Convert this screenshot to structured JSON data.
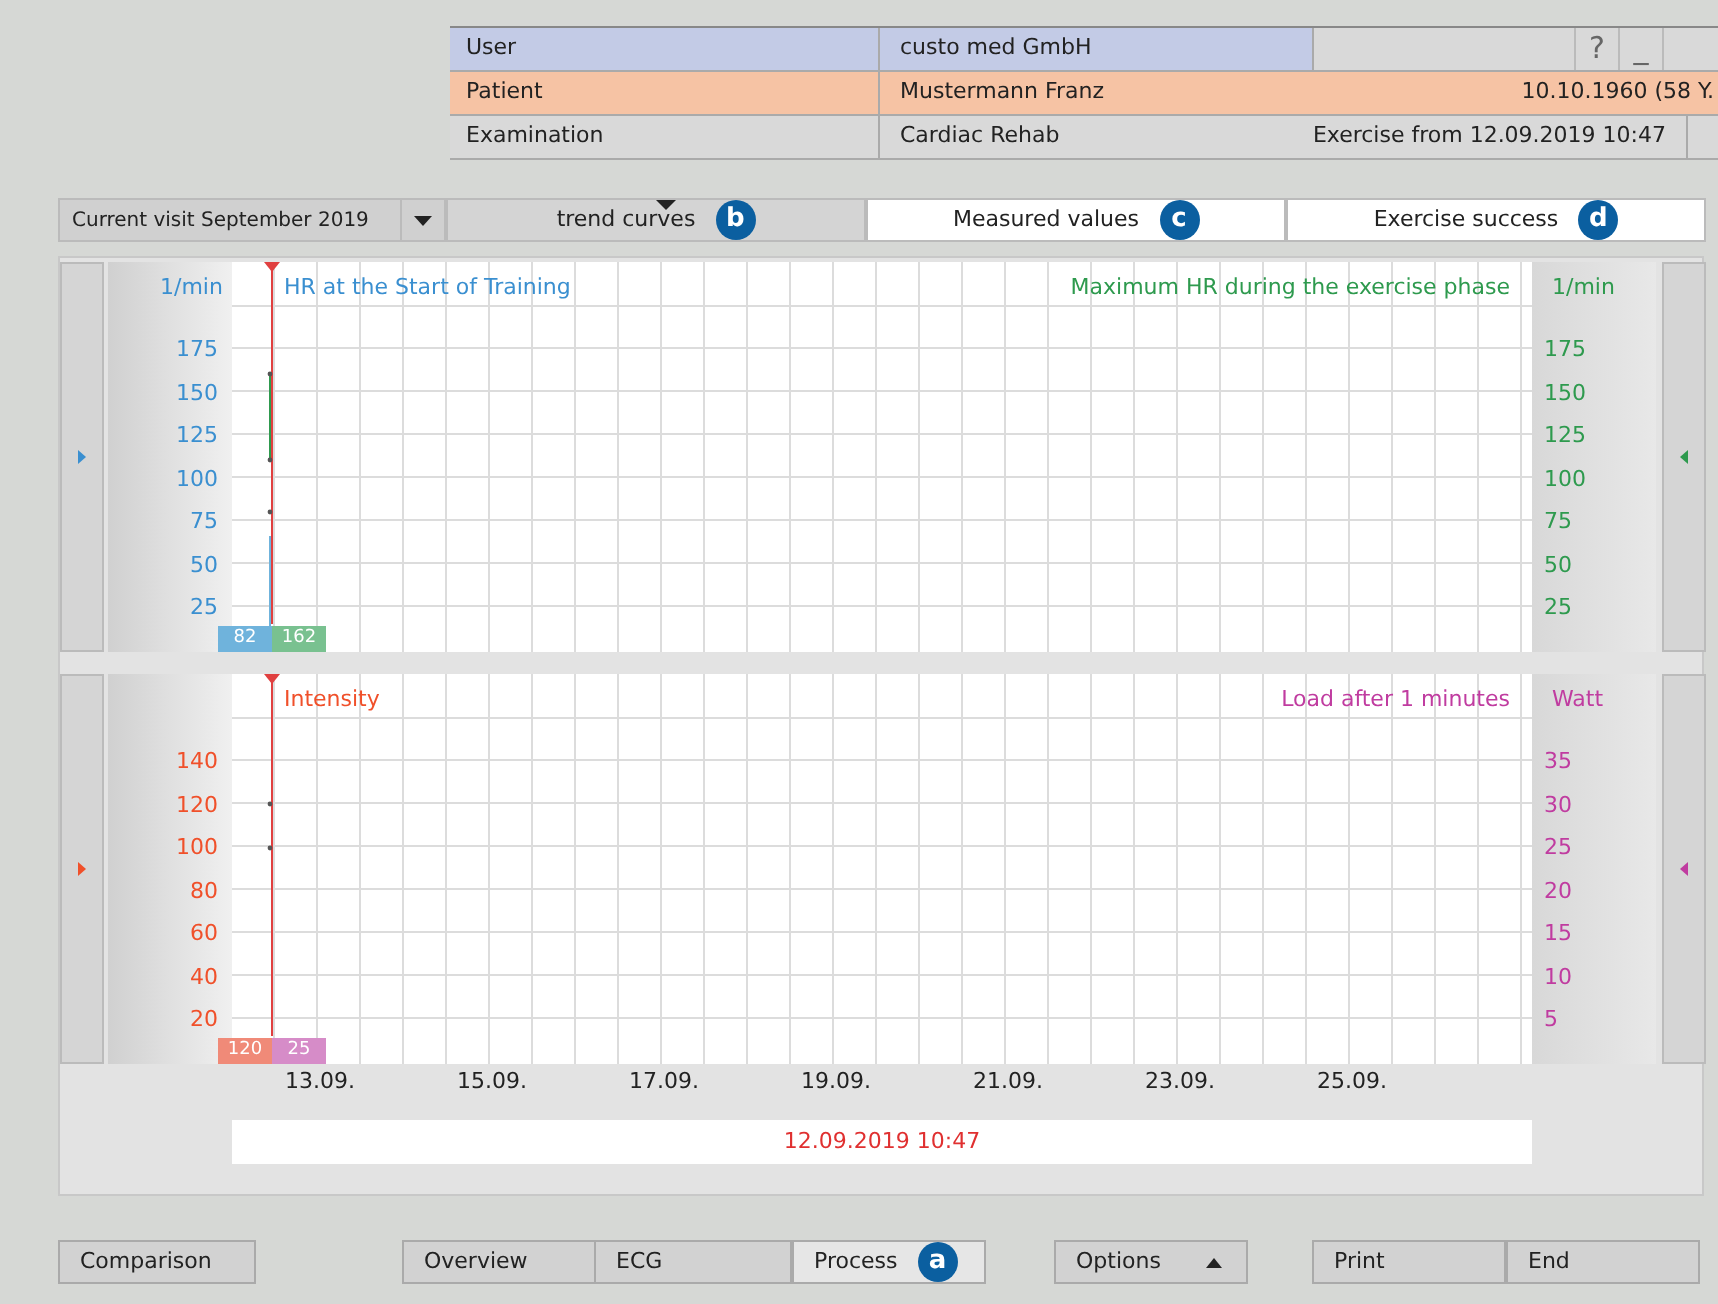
{
  "header": {
    "rows": [
      {
        "kind": "user",
        "label": "User",
        "value": "custo med GmbH",
        "buttons": [
          "?",
          "_"
        ]
      },
      {
        "kind": "patient",
        "label": "Patient",
        "value": "Mustermann Franz",
        "extra": "10.10.1960 (58 Y."
      },
      {
        "kind": "exam",
        "label": "Examination",
        "value": "Cardiac Rehab",
        "extra": "Exercise from 12.09.2019 10:47"
      }
    ]
  },
  "visit_dropdown": {
    "value": "Current visit September 2019"
  },
  "tabs": [
    {
      "label": "trend curves",
      "selected": true,
      "badge": "b"
    },
    {
      "label": "Measured values",
      "selected": false,
      "badge": "c"
    },
    {
      "label": "Exercise success",
      "selected": false,
      "badge": "d"
    }
  ],
  "charts": [
    {
      "left_axis": {
        "unit": "1/min",
        "title": "HR at the Start of Training",
        "color": "#3a8fd0",
        "ticks": [
          "175",
          "150",
          "125",
          "100",
          "75",
          "50",
          "25"
        ]
      },
      "right_axis": {
        "title": "Maximum HR during the exercise phase",
        "unit": "1/min",
        "color": "#2e9a4e",
        "ticks": [
          "175",
          "150",
          "125",
          "100",
          "75",
          "50",
          "25"
        ]
      },
      "readouts": [
        {
          "text": "82",
          "color": "#6fb3dc"
        },
        {
          "text": "162",
          "color": "#79c190"
        }
      ]
    },
    {
      "left_axis": {
        "title": "Intensity",
        "color": "#f0502a",
        "ticks": [
          "140",
          "120",
          "100",
          "80",
          "60",
          "40",
          "20"
        ]
      },
      "right_axis": {
        "title": "Load after 1 minutes",
        "unit": "Watt",
        "color": "#c03ca0",
        "ticks": [
          "35",
          "30",
          "25",
          "20",
          "15",
          "10",
          "5"
        ]
      },
      "readouts": [
        {
          "text": "120",
          "color": "#f08a78"
        },
        {
          "text": "25",
          "color": "#d68cc8"
        }
      ]
    }
  ],
  "dates": [
    "13.09.",
    "15.09.",
    "17.09.",
    "19.09.",
    "21.09.",
    "23.09.",
    "25.09."
  ],
  "selected_time": "12.09.2019 10:47",
  "bottom_buttons": [
    {
      "label": "Comparison",
      "selected": false
    },
    {
      "label": "Overview",
      "selected": false
    },
    {
      "label": "ECG",
      "selected": false
    },
    {
      "label": "Process",
      "selected": true,
      "badge": "a"
    },
    {
      "label": "Options",
      "selected": false,
      "menu": true
    },
    {
      "label": "Print",
      "selected": false
    },
    {
      "label": "End",
      "selected": false
    }
  ]
}
